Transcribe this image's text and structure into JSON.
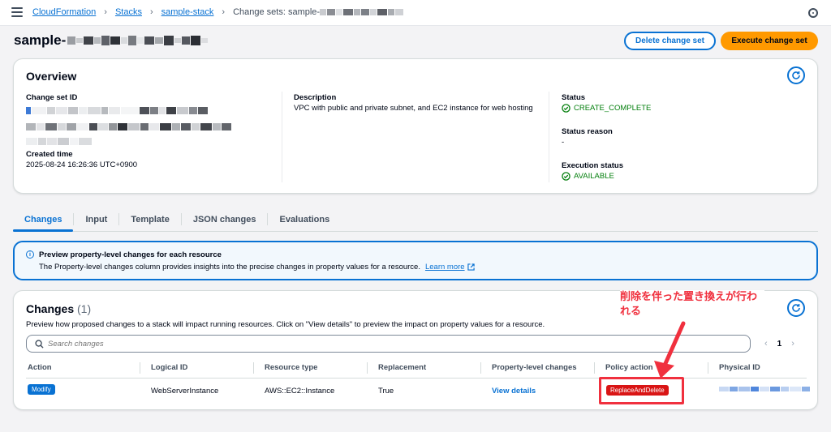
{
  "breadcrumbs": {
    "item1": "CloudFormation",
    "item2": "Stacks",
    "item3": "sample-stack",
    "current": "Change sets: sample-"
  },
  "page": {
    "title": "sample-",
    "delete_button": "Delete change set",
    "execute_button": "Execute change set"
  },
  "overview": {
    "heading": "Overview",
    "change_set_id_label": "Change set ID",
    "created_time_label": "Created time",
    "created_time": "2025-08-24 16:26:36 UTC+0900",
    "description_label": "Description",
    "description": "VPC with public and private subnet, and EC2 instance for web hosting",
    "status_label": "Status",
    "status": "CREATE_COMPLETE",
    "status_reason_label": "Status reason",
    "status_reason": "-",
    "execution_status_label": "Execution status",
    "execution_status": "AVAILABLE"
  },
  "tabs": [
    "Changes",
    "Input",
    "Template",
    "JSON changes",
    "Evaluations"
  ],
  "alert": {
    "title": "Preview property-level changes for each resource",
    "body": "The Property-level changes column provides insights into the precise changes in property values for a resource.",
    "link": "Learn more"
  },
  "changes": {
    "title": "Changes",
    "count": "(1)",
    "description": "Preview how proposed changes to a stack will impact running resources. Click on \"View details\" to preview the impact on property values for a resource.",
    "search_placeholder": "Search changes",
    "page": "1",
    "columns": [
      "Action",
      "Logical ID",
      "Resource type",
      "Replacement",
      "Property-level changes",
      "Policy action",
      "Physical ID"
    ],
    "rows": [
      {
        "action": "Modify",
        "logical_id": "WebServerInstance",
        "resource_type": "AWS::EC2::Instance",
        "replacement": "True",
        "property_changes": "View details",
        "policy_action": "ReplaceAndDelete"
      }
    ]
  },
  "annotation": "削除を伴った置き換えが行われる",
  "colors": {
    "accent": "#0972d3",
    "primary_button": "#ff9900",
    "success": "#037f0c",
    "danger": "#d91515",
    "annotation": "#f0303e"
  }
}
